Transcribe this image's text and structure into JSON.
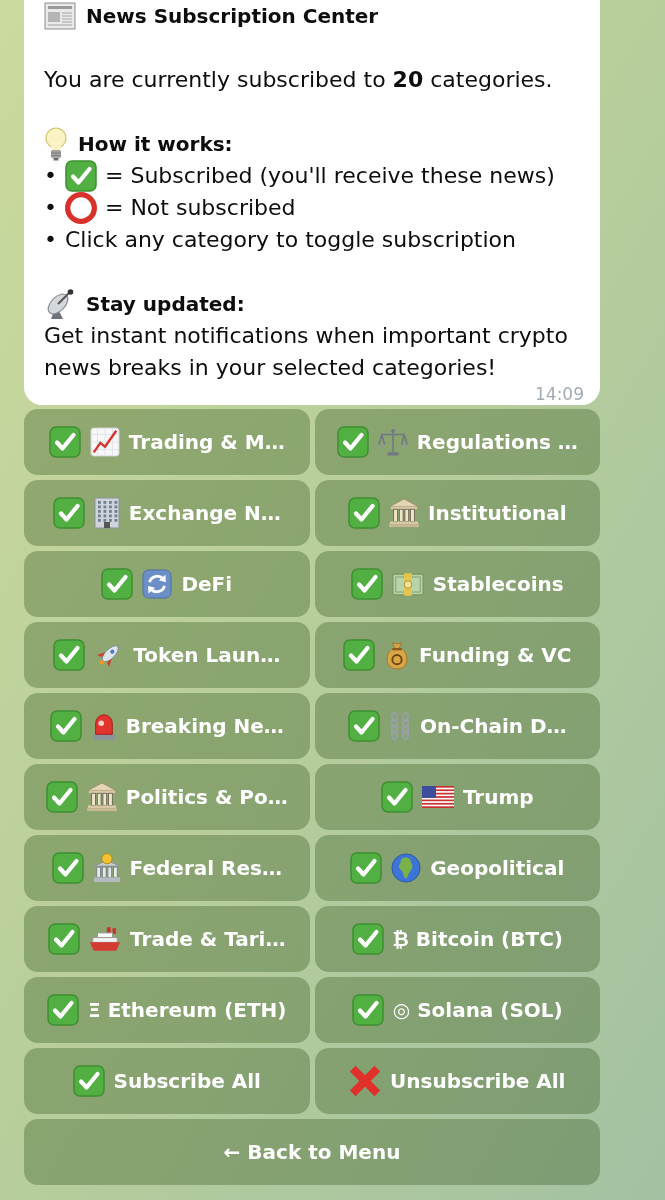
{
  "message": {
    "title": "News Subscription Center",
    "summary": "You are currently subscribed to **20** categories.",
    "how_it_works": {
      "heading": "How it works:",
      "items": [
        {
          "kind": "subscribed",
          "bullet": "•",
          "text": "= Subscribed (you'll receive these news)"
        },
        {
          "kind": "not_subscribed",
          "bullet": "•",
          "text": "= Not subscribed"
        },
        {
          "kind": "plain",
          "bullet": "•",
          "text": "Click any category to toggle subscription"
        }
      ]
    },
    "stay_updated": {
      "heading": "Stay updated:",
      "text": "Get instant notifications when important crypto news breaks in your selected categories!"
    },
    "time": "14:09"
  },
  "categories": [
    {
      "label": "Trading & M…",
      "subscribed": true
    },
    {
      "label": "Regulations …",
      "subscribed": true
    },
    {
      "label": "Exchange N…",
      "subscribed": true
    },
    {
      "label": "Institutional",
      "subscribed": true
    },
    {
      "label": "DeFi",
      "subscribed": true
    },
    {
      "label": "Stablecoins",
      "subscribed": true
    },
    {
      "label": "Token Laun…",
      "subscribed": true
    },
    {
      "label": "Funding & VC",
      "subscribed": true
    },
    {
      "label": "Breaking Ne…",
      "subscribed": true
    },
    {
      "label": "On-Chain D…",
      "subscribed": true
    },
    {
      "label": "Politics & Po…",
      "subscribed": true
    },
    {
      "label": "Trump",
      "subscribed": true
    },
    {
      "label": "Federal Res…",
      "subscribed": true
    },
    {
      "label": "Geopolitical",
      "subscribed": true
    },
    {
      "label": "Trade & Tari…",
      "subscribed": true
    },
    {
      "label": "₿ Bitcoin (BTC)",
      "subscribed": true
    },
    {
      "label": "Ξ Ethereum (ETH)",
      "subscribed": true
    },
    {
      "label": "◎ Solana (SOL)",
      "subscribed": true
    }
  ],
  "bulk_actions": [
    {
      "kind": "subscribe",
      "label": "Subscribe All"
    },
    {
      "kind": "unsubscribe",
      "label": "Unsubscribe All"
    }
  ],
  "back_button": {
    "label": "← Back to Menu"
  }
}
